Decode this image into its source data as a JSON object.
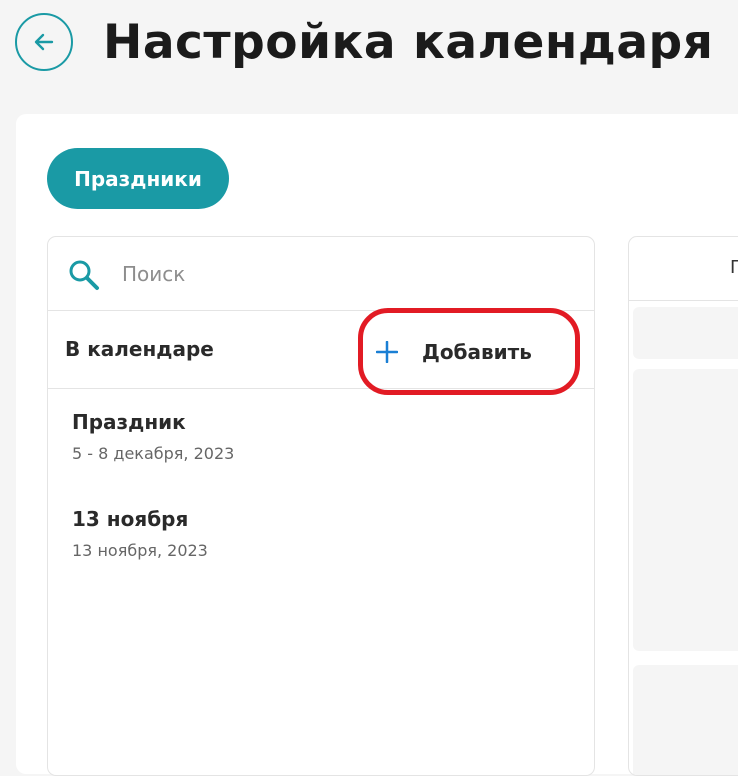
{
  "header": {
    "title": "Настройка календаря",
    "back_icon": "arrow-left-icon",
    "accent_color": "#1a9aa5"
  },
  "tabs": [
    {
      "label": "Праздники",
      "active": true
    }
  ],
  "search": {
    "placeholder": "Поиск",
    "value": "",
    "icon": "search-icon"
  },
  "section": {
    "label": "В календаре",
    "add_label": "Добавить",
    "add_icon": "plus-icon",
    "add_color": "#1a7fd4",
    "highlight_color": "#e21b24"
  },
  "holidays": [
    {
      "title": "Праздник",
      "date": "5 - 8 декабря, 2023"
    },
    {
      "title": "13 ноября",
      "date": "13 ноября, 2023"
    }
  ],
  "right_panel": {
    "header_text": "П"
  }
}
